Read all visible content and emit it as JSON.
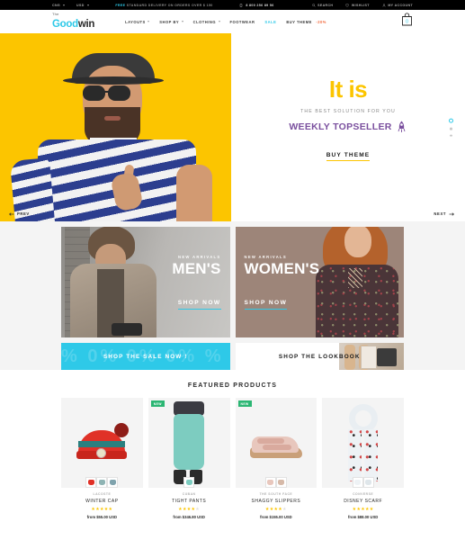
{
  "topbar": {
    "currency": "CNG",
    "language": "USD",
    "promo_free": "FREE",
    "promo_text": "STANDARD DELIVERY ON ORDERS OVER $ 150",
    "phone": "8 800 256 89 56",
    "search": "SEARCH",
    "wishlist": "WISHLIST",
    "account": "MY ACCOUNT"
  },
  "header": {
    "logo_the": "The",
    "logo_good": "Good",
    "logo_win": "win",
    "nav": [
      {
        "label": "LAYOUTS",
        "caret": true
      },
      {
        "label": "SHOP BY",
        "caret": true
      },
      {
        "label": "CLOTHING",
        "caret": true
      },
      {
        "label": "FOOTWEAR",
        "caret": false
      },
      {
        "label": "SALE",
        "caret": false
      },
      {
        "label": "BUY THEME",
        "caret": false
      }
    ],
    "buy_theme_discount": "-20%",
    "cart_count": "0"
  },
  "hero": {
    "headline": "It is",
    "subhead": "THE BEST SOLUTION FOR YOU",
    "topseller": "WEEKLY TOPSELLER",
    "cta": "BUY THEME",
    "prev": "PREV",
    "next": "NEXT"
  },
  "categories": [
    {
      "kicker": "NEW ARRIVALS",
      "title": "MEN'S",
      "cta": "SHOP NOW"
    },
    {
      "kicker": "NEW ARRIVALS",
      "title": "WOMEN'S",
      "cta": "SHOP NOW"
    }
  ],
  "strips": {
    "sale": "SHOP THE SALE NOW !",
    "sale_pattern": "% 0% 0% 0% %",
    "lookbook": "SHOP THE LOOKBOOK"
  },
  "featured": {
    "title": "FEATURED PRODUCTS",
    "products": [
      {
        "brand": "LACOSTE",
        "name": "WINTER CAP",
        "rating": 5,
        "price": "from $55.00 USD",
        "badge": "",
        "swatches": [
          "#e03127",
          "#8fb4b4",
          "#7fa3ad"
        ]
      },
      {
        "brand": "CUBAN",
        "name": "TIGHT PANTS",
        "rating": 4,
        "price": "from $346.80 USD",
        "badge": "NEW",
        "swatches": [
          "#7dccc0"
        ]
      },
      {
        "brand": "THE SOUTH FACE",
        "name": "SHAGGY SLIPPERS",
        "rating": 4,
        "price": "from $155.00 USD",
        "badge": "NEW",
        "swatches": [
          "#e8c7bd",
          "#d6b9a8"
        ]
      },
      {
        "brand": "CONVERSE",
        "name": "DISNEY SCARF",
        "rating": 5,
        "price": "from $88.00 USD",
        "badge": "",
        "swatches": [
          "#eef2f5",
          "#dfe6ea"
        ]
      }
    ]
  },
  "colors": {
    "accent_cyan": "#2ec9e8",
    "accent_yellow": "#fcc500",
    "purple": "#7a4f9e",
    "orange": "#f2693c",
    "green": "#2bb673"
  }
}
